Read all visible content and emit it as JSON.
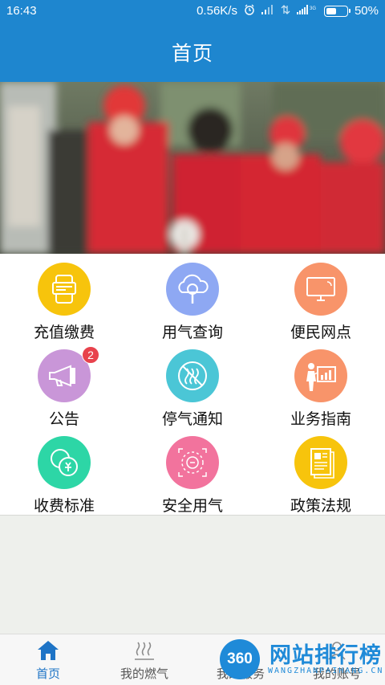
{
  "status_bar": {
    "time": "16:43",
    "network_speed": "0.56K/s",
    "network_type": "3G",
    "battery_percent": "50%",
    "battery_level": 0.5
  },
  "header": {
    "title": "首页"
  },
  "banner": {
    "image": "gas-workers-photo"
  },
  "services": [
    {
      "label": "充值缴费",
      "icon": "payment-card-icon",
      "color": "#f7c40c"
    },
    {
      "label": "用气查询",
      "icon": "cloud-search-icon",
      "color": "#8ea8f3"
    },
    {
      "label": "便民网点",
      "icon": "monitor-icon",
      "color": "#f8946a"
    },
    {
      "label": "公告",
      "icon": "megaphone-icon",
      "color": "#c996d8",
      "badge": "2"
    },
    {
      "label": "停气通知",
      "icon": "no-gas-icon",
      "color": "#4bc6d6"
    },
    {
      "label": "业务指南",
      "icon": "presentation-icon",
      "color": "#f8946a"
    },
    {
      "label": "收费标准",
      "icon": "coins-icon",
      "color": "#2dd6a6"
    },
    {
      "label": "安全用气",
      "icon": "safety-icon",
      "color": "#f2739d"
    },
    {
      "label": "政策法规",
      "icon": "document-icon",
      "color": "#f7c40c"
    }
  ],
  "bottom_nav": [
    {
      "label": "首页",
      "icon": "home-icon",
      "active": true
    },
    {
      "label": "我的燃气",
      "icon": "gas-steam-icon",
      "active": false
    },
    {
      "label": "我的服务",
      "icon": "service-icon",
      "active": false
    },
    {
      "label": "我的账号",
      "icon": "account-icon",
      "active": false
    }
  ],
  "watermark": {
    "badge": "360",
    "title": "网站排行榜",
    "subtitle": "WANGZHANPAIHANG.CN"
  },
  "colors": {
    "primary": "#1e86cf",
    "active_nav": "#1e74c6",
    "badge": "#e8424c"
  }
}
